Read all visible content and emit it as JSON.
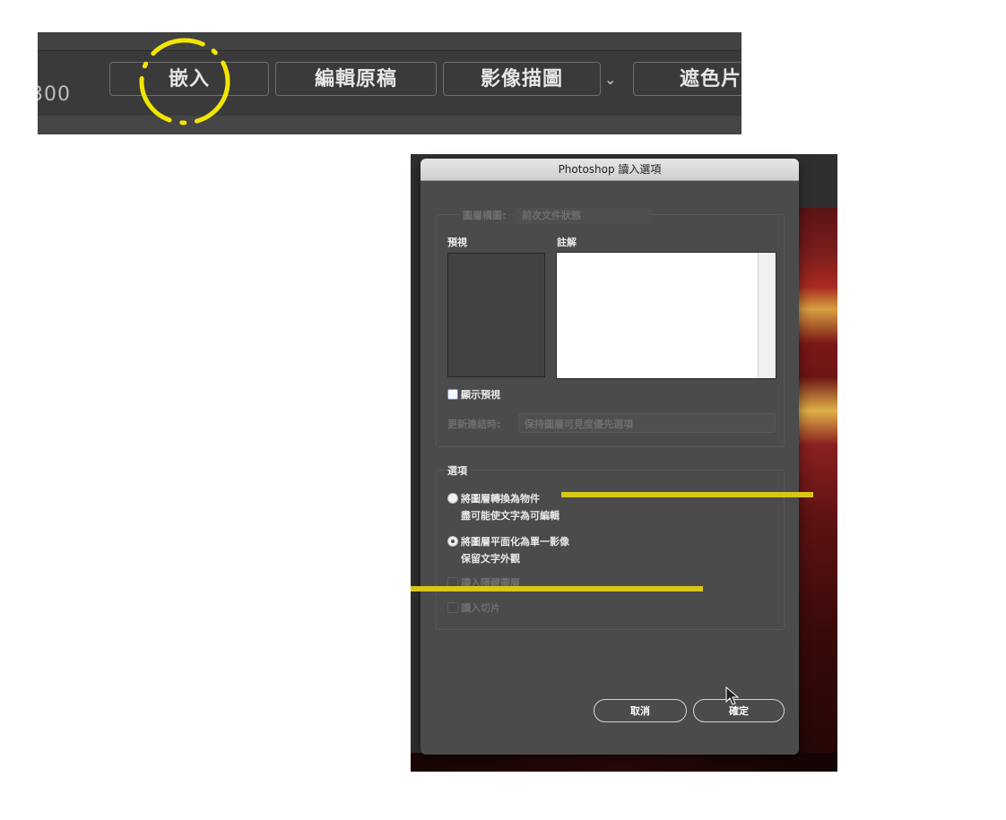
{
  "toolbar": {
    "number_fragment": "300",
    "buttons": [
      "嵌入",
      "編輯原稿",
      "影像描圖",
      "遮色片"
    ],
    "dropdown_arrow": "chevron-down-icon"
  },
  "dialog": {
    "title": "Photoshop 讀入選項",
    "layer_comp_label": "圖層構圖:",
    "layer_comp_value": "前次文件狀態",
    "preview_label": "預視",
    "notes_label": "註解",
    "show_preview_label": "顯示預視",
    "update_links_label": "更新連結時:",
    "update_links_value": "保持圖層可見度優先選項",
    "options_label": "選項",
    "radio1_label": "將圖層轉換為物件",
    "radio1_hint": "盡可能使文字為可編輯",
    "radio2_label": "將圖層平面化為單一影像",
    "radio2_hint": "保留文字外觀",
    "check_hidden_layers": "讀入隱藏圖層",
    "check_slices": "讀入切片",
    "cancel_label": "取消",
    "ok_label": "確定"
  },
  "colors": {
    "annotation": "#f2e600",
    "dialog_bg": "#4b4b4b",
    "toolbar_bg": "#3a3a3a"
  }
}
